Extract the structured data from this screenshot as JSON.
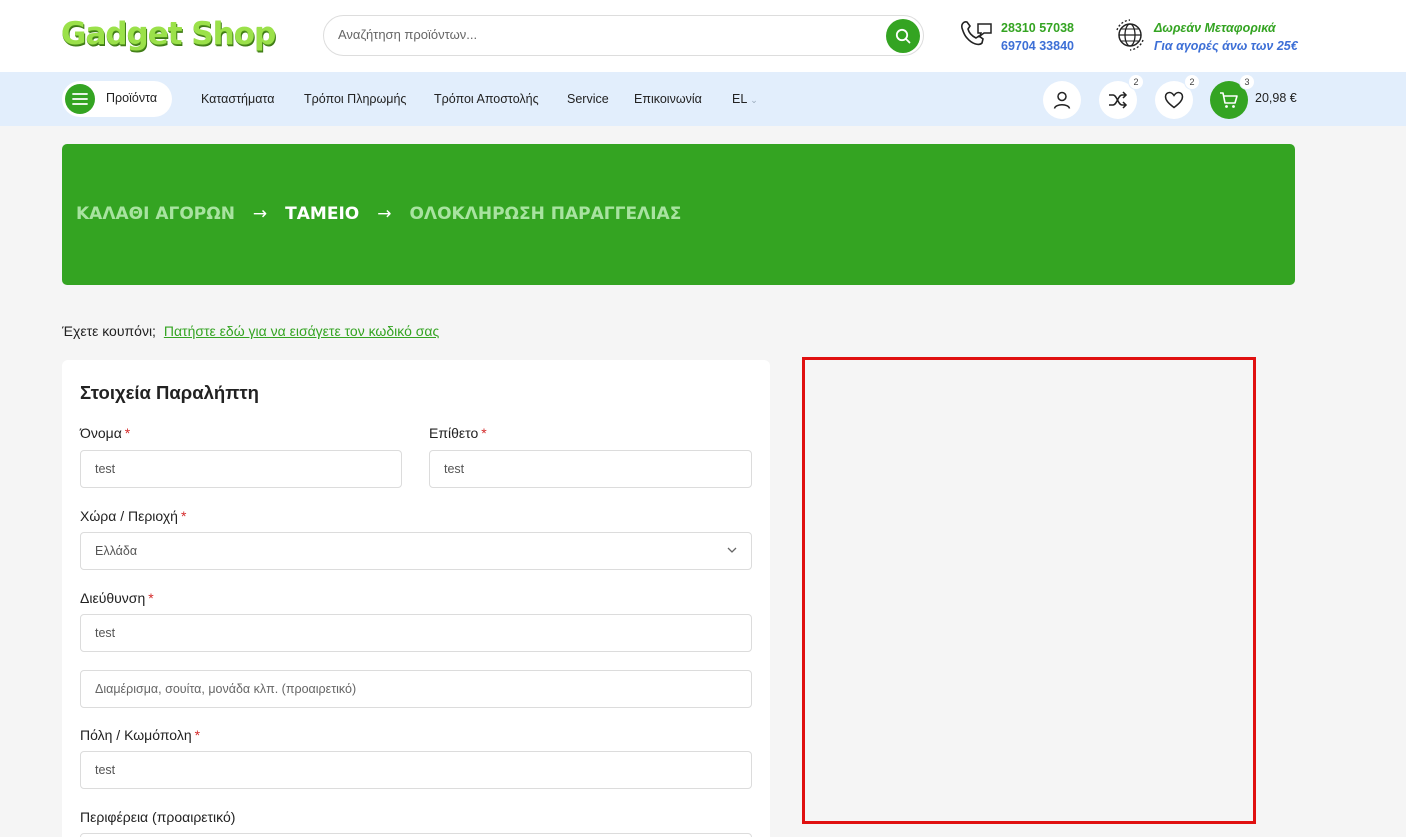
{
  "header": {
    "logo": "Gadget Shop",
    "search_placeholder": "Αναζήτηση προϊόντων...",
    "phone_1": "28310 57038",
    "phone_2": "69704 33840",
    "shipping_title": "Δωρεάν Μεταφορικά",
    "shipping_sub": "Για αγορές άνω των 25€"
  },
  "nav": {
    "products_label": "Προϊόντα",
    "links": [
      "Καταστήματα",
      "Τρόποι Πληρωμής",
      "Τρόποι Αποστολής",
      "Service",
      "Επικοινωνία",
      "EL"
    ],
    "compare_count": "2",
    "wishlist_count": "2",
    "cart_count": "3",
    "cart_total": "20,98 €"
  },
  "breadcrumb": {
    "step_1": "ΚΑΛΑΘΙ ΑΓΟΡΩΝ",
    "step_2": "ΤΑΜΕΙΟ",
    "step_3": "ΟΛΟΚΛΗΡΩΣΗ ΠΑΡΑΓΓΕΛΙΑΣ",
    "arrow": "→"
  },
  "coupon": {
    "question": "Έχετε κουπόνι;",
    "link": "Πατήστε εδώ για να εισάγετε τον κωδικό σας"
  },
  "form": {
    "title": "Στοιχεία Παραλήπτη",
    "required_mark": "*",
    "first_name_label": "Όνομα",
    "first_name_value": "test",
    "last_name_label": "Επίθετο",
    "last_name_value": "test",
    "country_label": "Χώρα / Περιοχή",
    "country_value": "Ελλάδα",
    "address_label": "Διεύθυνση",
    "address_value": "test",
    "address2_placeholder": "Διαμέρισμα, σουίτα, μονάδα κλπ. (προαιρετικό)",
    "city_label": "Πόλη / Κωμόπολη",
    "city_value": "test",
    "region_label": "Περιφέρεια (προαιρετικό)"
  },
  "colors": {
    "brand_green": "#34a422",
    "link_blue": "#3d6fd6",
    "nav_bg": "#e2eefc",
    "highlight_red": "#e01010"
  }
}
